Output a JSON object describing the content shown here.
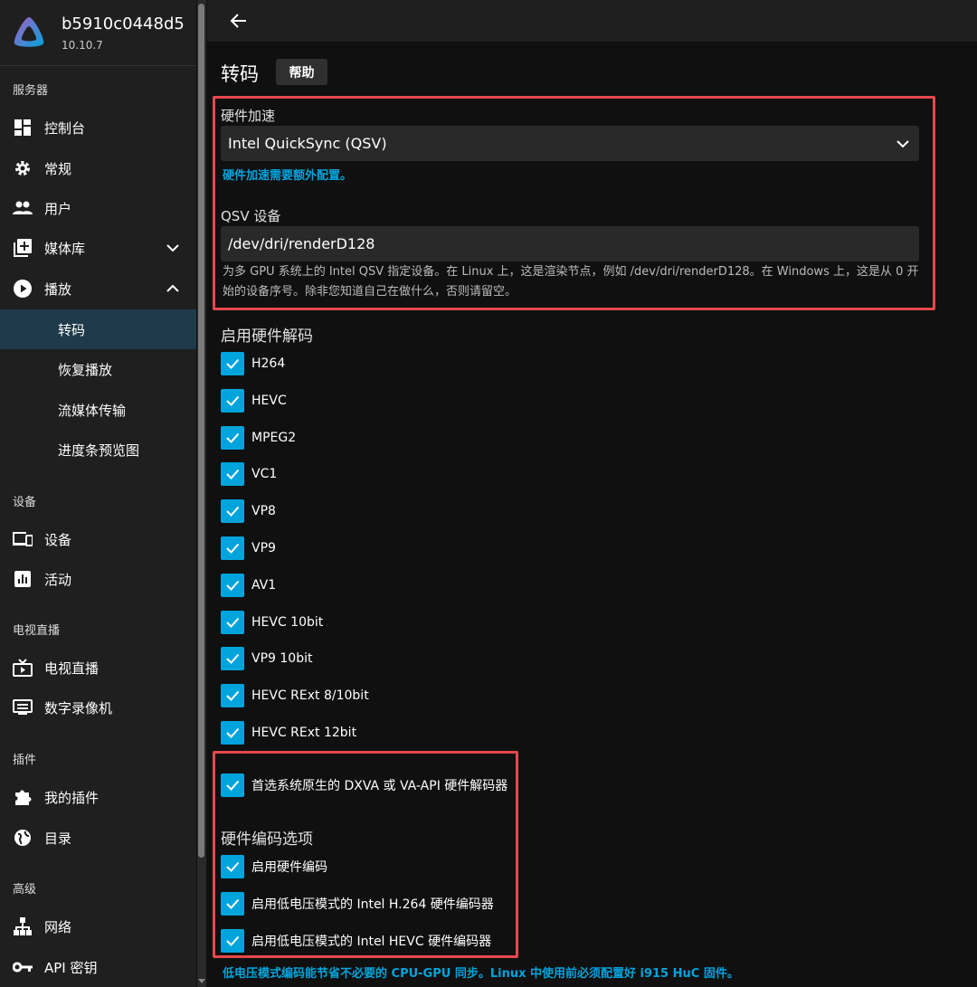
{
  "server": {
    "name": "b5910c0448d5",
    "version": "10.10.7"
  },
  "sidebar": {
    "sections": {
      "server": "服务器",
      "devices": "设备",
      "livetv": "电视直播",
      "plugins": "插件",
      "advanced": "高级"
    },
    "items": {
      "dashboard": "控制台",
      "general": "常规",
      "users": "用户",
      "libraries": "媒体库",
      "playback": "播放",
      "transcoding": "转码",
      "resume": "恢复播放",
      "streaming": "流媒体传输",
      "trickplay": "进度条预览图",
      "devices": "设备",
      "activity": "活动",
      "livetv": "电视直播",
      "dvr": "数字录像机",
      "myplugins": "我的插件",
      "catalog": "目录",
      "networking": "网络",
      "apikeys": "API 密钥"
    }
  },
  "page": {
    "title": "转码",
    "help_label": "帮助",
    "hw_accel_label": "硬件加速",
    "hw_accel_value": "Intel QuickSync (QSV)",
    "hw_accel_note": "硬件加速需要额外配置。",
    "qsv_label": "QSV 设备",
    "qsv_value": "/dev/dri/renderD128",
    "qsv_desc": "为多 GPU 系统上的 Intel QSV 指定设备。在 Linux 上，这是渲染节点，例如 /dev/dri/renderD128。在 Windows 上，这是从 0 开始的设备序号。除非您知道自己在做什么，否则请留空。",
    "hw_decode_title": "启用硬件解码",
    "codecs": [
      "H264",
      "HEVC",
      "MPEG2",
      "VC1",
      "VP8",
      "VP9",
      "AV1",
      "HEVC 10bit",
      "VP9 10bit",
      "HEVC RExt 8/10bit",
      "HEVC RExt 12bit"
    ],
    "prefer_native": "首选系统原生的 DXVA 或 VA-API 硬件解码器",
    "hw_encode_title": "硬件编码选项",
    "enable_hw_encode": "启用硬件编码",
    "low_power_h264": "启用低电压模式的 Intel H.264 硬件编码器",
    "low_power_hevc": "启用低电压模式的 Intel HEVC 硬件编码器",
    "low_power_note": "低电压模式编码能节省不必要的 CPU-GPU 同步。Linux 中使用前必须配置好 i915 HuC 固件。"
  },
  "colors": {
    "accent": "#00a4dc",
    "highlight": "#e5484d",
    "active_bg": "#1e3a4b"
  }
}
